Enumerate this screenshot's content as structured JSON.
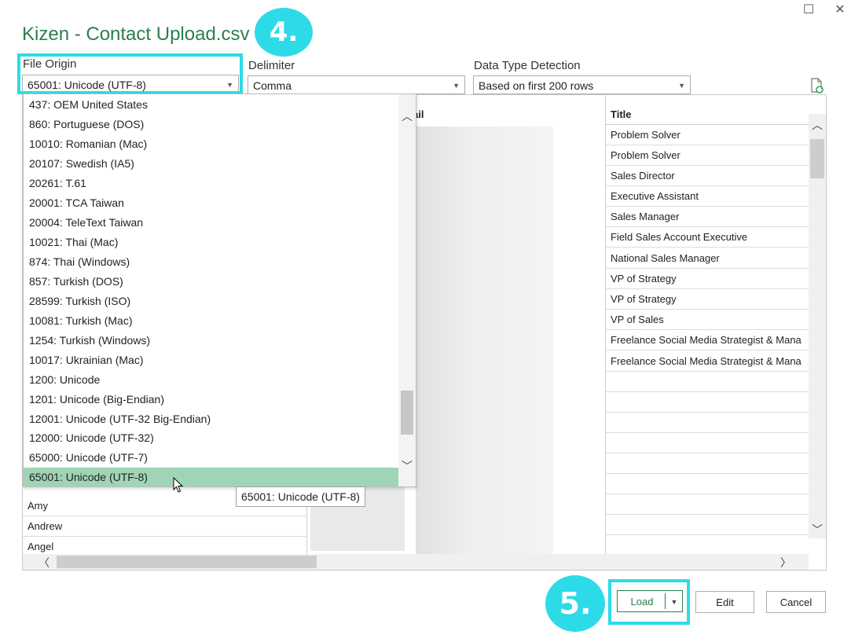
{
  "window": {
    "title": "Kizen - Contact Upload.csv",
    "maximize_icon": "☐",
    "close_icon": "✕"
  },
  "annotations": {
    "step4": "4.",
    "step5": "5."
  },
  "file_origin": {
    "label": "File Origin",
    "value": "65001: Unicode (UTF-8)"
  },
  "delimiter": {
    "label": "Delimiter",
    "value": "Comma"
  },
  "data_type_detection": {
    "label": "Data Type Detection",
    "value": "Based on first 200 rows"
  },
  "dropdown": {
    "options": [
      "437: OEM United States",
      "860: Portuguese (DOS)",
      "10010: Romanian (Mac)",
      "20107: Swedish (IA5)",
      "20261: T.61",
      "20001: TCA Taiwan",
      "20004: TeleText Taiwan",
      "10021: Thai (Mac)",
      "874: Thai (Windows)",
      "857: Turkish (DOS)",
      "28599: Turkish (ISO)",
      "10081: Turkish (Mac)",
      "1254: Turkish (Windows)",
      "10017: Ukrainian (Mac)",
      "1200: Unicode",
      "1201: Unicode (Big-Endian)",
      "12001: Unicode (UTF-32 Big-Endian)",
      "12000: Unicode (UTF-32)",
      "65000: Unicode (UTF-7)",
      "65001: Unicode (UTF-8)"
    ],
    "selected": "65001: Unicode (UTF-8)",
    "tooltip": "65001: Unicode (UTF-8)"
  },
  "preview": {
    "columns": {
      "email": "ail",
      "title": "Title"
    },
    "titles": [
      "Problem Solver",
      "Problem Solver",
      "Sales Director",
      "Executive Assistant",
      "Sales Manager",
      "Field Sales Account Executive",
      "National Sales Manager",
      "VP of Strategy",
      "VP of Strategy",
      "VP of Sales",
      "Freelance Social Media Strategist & Mana",
      "Freelance Social Media Strategist & Mana"
    ],
    "first_names_visible": [
      "Amy",
      "Andrew",
      "Angel"
    ]
  },
  "buttons": {
    "load": "Load",
    "edit": "Edit",
    "cancel": "Cancel"
  },
  "colors": {
    "accent_cyan": "#2ddbe8",
    "title_green": "#2e7d4f",
    "selection_green": "#9fd5b6"
  }
}
